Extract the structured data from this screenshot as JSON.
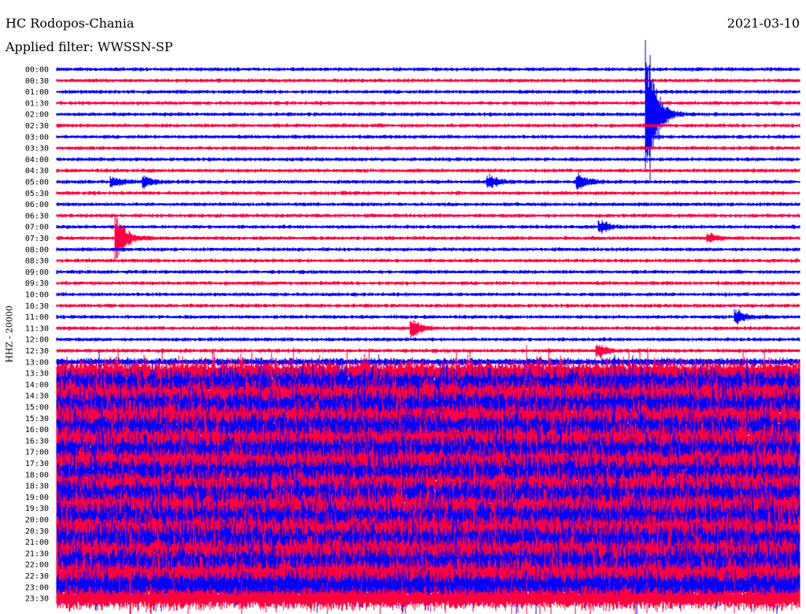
{
  "header": {
    "station": "HC Rodopos-Chania",
    "filter": "Applied filter: WWSSN-SP",
    "date": "2021-03-10"
  },
  "chart_data": {
    "type": "line",
    "title": "HC Rodopos-Chania",
    "ylabel": "HHZ - 20000",
    "xlabel": "",
    "minutes_per_line": 30,
    "colors": [
      "#0000ff",
      "#ff0040"
    ],
    "row_labels": [
      "00:00",
      "00:30",
      "01:00",
      "01:30",
      "02:00",
      "02:30",
      "03:00",
      "03:30",
      "04:00",
      "04:30",
      "05:00",
      "05:30",
      "06:00",
      "06:30",
      "07:00",
      "07:30",
      "08:00",
      "08:30",
      "09:00",
      "09:30",
      "10:00",
      "10:30",
      "11:00",
      "11:30",
      "12:00",
      "12:30",
      "13:00",
      "13:30",
      "14:00",
      "14:30",
      "15:00",
      "15:30",
      "16:00",
      "16:30",
      "17:00",
      "17:30",
      "18:00",
      "18:30",
      "19:00",
      "19:30",
      "20:00",
      "20:30",
      "21:00",
      "21:30",
      "22:00",
      "22:30",
      "23:00",
      "23:30"
    ],
    "noise_level": [
      3,
      3,
      3,
      3,
      3,
      3,
      3,
      3,
      3,
      3,
      3,
      3,
      3,
      3,
      3,
      3,
      3,
      3,
      3,
      3,
      3,
      3,
      3,
      3,
      3,
      3,
      6,
      22,
      24,
      26,
      26,
      26,
      26,
      26,
      26,
      26,
      26,
      26,
      28,
      28,
      28,
      28,
      28,
      28,
      28,
      28,
      24,
      18
    ],
    "events": [
      {
        "row": 15,
        "minute": 2.5,
        "amplitude": 35
      },
      {
        "row": 10,
        "minute": 2.3,
        "amplitude": 8
      },
      {
        "row": 10,
        "minute": 3.6,
        "amplitude": 7
      },
      {
        "row": 4,
        "minute": 23.9,
        "amplitude": 110
      },
      {
        "row": 14,
        "minute": 22.0,
        "amplitude": 8
      },
      {
        "row": 15,
        "minute": 26.4,
        "amplitude": 7
      },
      {
        "row": 23,
        "minute": 14.4,
        "amplitude": 12
      },
      {
        "row": 25,
        "minute": 21.9,
        "amplitude": 10
      },
      {
        "row": 22,
        "minute": 27.5,
        "amplitude": 10
      },
      {
        "row": 10,
        "minute": 17.5,
        "amplitude": 10
      },
      {
        "row": 10,
        "minute": 21.1,
        "amplitude": 12
      }
    ]
  }
}
